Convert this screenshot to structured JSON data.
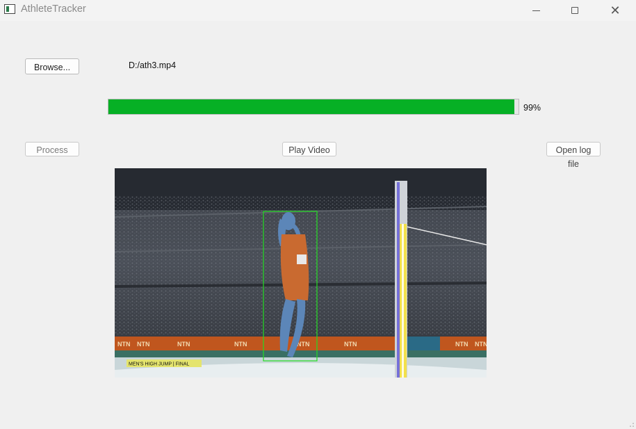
{
  "window": {
    "title": "AthleteTracker",
    "controls": [
      "minimize-icon",
      "maximize-icon",
      "close-icon"
    ],
    "close_glyph": "✕"
  },
  "file": {
    "browse_label": "Browse...",
    "path": "D:/ath3.mp4"
  },
  "progress": {
    "value": 99,
    "label": "99%",
    "fill_color": "#06b025"
  },
  "actions": {
    "process_label": "Process",
    "play_label": "Play Video",
    "log_label": "Open log file"
  },
  "video": {
    "caption": "MEN'S HIGH JUMP | FINAL",
    "board_text": "NTN",
    "detection_box_color": "#22dd22"
  }
}
